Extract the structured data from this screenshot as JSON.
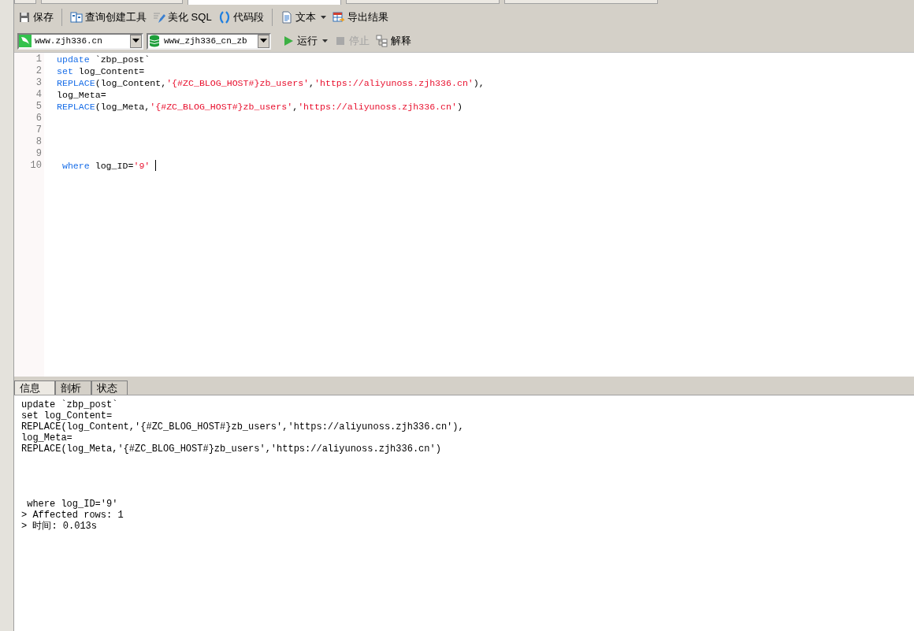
{
  "document_tabs": [
    {
      "selected": false
    },
    {
      "selected": false
    },
    {
      "selected": true
    },
    {
      "selected": false
    },
    {
      "selected": false
    }
  ],
  "toolbar": {
    "buttons": [
      {
        "kind": "save",
        "label": "保存"
      },
      {
        "kind": "separator"
      },
      {
        "kind": "query-builder",
        "label": "查询创建工具"
      },
      {
        "kind": "beautify",
        "label": "美化 SQL"
      },
      {
        "kind": "snippet",
        "label": "代码段"
      },
      {
        "kind": "separator"
      },
      {
        "kind": "text",
        "label": "文本",
        "dropdown": true
      },
      {
        "kind": "export",
        "label": "导出结果"
      }
    ]
  },
  "connection": {
    "value": "www.zjh336.cn"
  },
  "database": {
    "value": "www_zjh336_cn_zb"
  },
  "actions": [
    {
      "kind": "run",
      "label": "运行",
      "dropdown": true,
      "disabled": false
    },
    {
      "kind": "stop",
      "label": "停止",
      "disabled": true
    },
    {
      "kind": "explain",
      "label": "解释",
      "disabled": false
    }
  ],
  "editor": {
    "lines": [
      {
        "number": "1",
        "tokens": [
          {
            "kind": "keyword",
            "text": "update"
          },
          {
            "kind": "plain",
            "text": " `zbp_post`"
          }
        ]
      },
      {
        "number": "2",
        "tokens": [
          {
            "kind": "keyword",
            "text": "set"
          },
          {
            "kind": "plain",
            "text": " log_Content="
          }
        ]
      },
      {
        "number": "3",
        "tokens": [
          {
            "kind": "keyword",
            "text": "REPLACE"
          },
          {
            "kind": "plain",
            "text": "(log_Content,"
          },
          {
            "kind": "string",
            "text": "'{#ZC_BLOG_HOST#}zb_users'"
          },
          {
            "kind": "plain",
            "text": ","
          },
          {
            "kind": "string",
            "text": "'https://aliyunoss.zjh336.cn'"
          },
          {
            "kind": "plain",
            "text": "),"
          }
        ]
      },
      {
        "number": "4",
        "tokens": [
          {
            "kind": "plain",
            "text": "log_Meta="
          }
        ]
      },
      {
        "number": "5",
        "tokens": [
          {
            "kind": "keyword",
            "text": "REPLACE"
          },
          {
            "kind": "plain",
            "text": "(log_Meta,"
          },
          {
            "kind": "string",
            "text": "'{#ZC_BLOG_HOST#}zb_users'"
          },
          {
            "kind": "plain",
            "text": ","
          },
          {
            "kind": "string",
            "text": "'https://aliyunoss.zjh336.cn'"
          },
          {
            "kind": "plain",
            "text": ")"
          }
        ]
      },
      {
        "number": "6"
      },
      {
        "number": "7"
      },
      {
        "number": "8"
      },
      {
        "number": "9"
      },
      {
        "number": "10",
        "cursor": true,
        "tokens": [
          {
            "kind": "keyword",
            "text": " where"
          },
          {
            "kind": "plain",
            "text": " log_ID="
          },
          {
            "kind": "string",
            "text": "'9'"
          }
        ]
      }
    ]
  },
  "result_tabs": [
    {
      "label": "信息",
      "selected": true
    },
    {
      "label": "剖析",
      "selected": false
    },
    {
      "label": "状态",
      "selected": false
    }
  ],
  "output": {
    "statement_lines": [
      "update `zbp_post`",
      "set log_Content=",
      "REPLACE(log_Content,'{#ZC_BLOG_HOST#}zb_users','https://aliyunoss.zjh336.cn'),",
      "log_Meta=",
      "REPLACE(log_Meta,'{#ZC_BLOG_HOST#}zb_users','https://aliyunoss.zjh336.cn')"
    ],
    "tail_lines": [
      " where log_ID='9'",
      "> Affected rows: 1",
      "> 时间: 0.013s"
    ]
  }
}
